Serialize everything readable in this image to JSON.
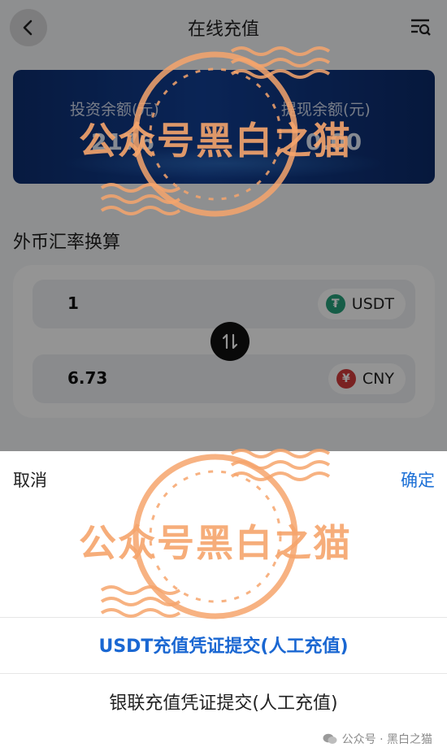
{
  "header": {
    "title": "在线充值"
  },
  "balance": {
    "invest_label": "投资余额(元)",
    "invest_value": "2176",
    "withdraw_label": "提现余额(元)",
    "withdraw_value": "0.00"
  },
  "exchange": {
    "section_title": "外币汇率换算",
    "from": {
      "amount": "1",
      "currency": "USDT",
      "coin_glyph": "₮",
      "color": "#26a17b"
    },
    "to": {
      "amount": "6.73",
      "currency": "CNY",
      "coin_glyph": "¥",
      "color": "#d33b3b"
    }
  },
  "sheet": {
    "cancel_label": "取消",
    "confirm_label": "确定",
    "options": [
      "USDT充值凭证提交(人工充值)",
      "银联充值凭证提交(人工充值)"
    ],
    "accent_color": "#1a67d2"
  },
  "watermark": {
    "text": "公众号黑白之猫",
    "footer": "公众号 · 黑白之猫"
  },
  "icons": {
    "back": "chevron-left-icon",
    "menu": "list-search-icon",
    "swap": "swap-vertical-icon",
    "wechat": "wechat-icon"
  }
}
